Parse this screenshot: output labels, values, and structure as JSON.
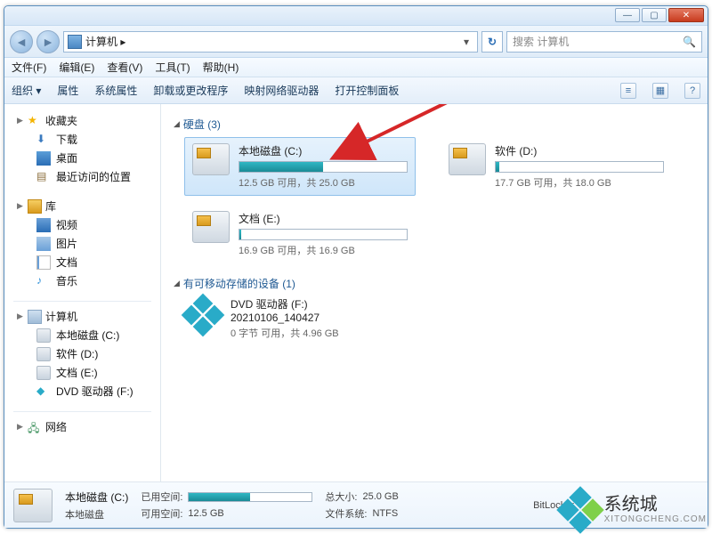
{
  "window_controls": {
    "min": "—",
    "max": "▢",
    "close": "✕"
  },
  "nav": {
    "back": "◄",
    "fwd": "►",
    "breadcrumb_icon": "pc",
    "breadcrumb": "计算机 ▸",
    "dropdown": "▾",
    "refresh": "↻",
    "search_placeholder": "搜索 计算机",
    "search_icon": "🔍"
  },
  "menubar": [
    "文件(F)",
    "编辑(E)",
    "查看(V)",
    "工具(T)",
    "帮助(H)"
  ],
  "toolbar": {
    "items": [
      "组织 ▾",
      "属性",
      "系统属性",
      "卸载或更改程序",
      "映射网络驱动器",
      "打开控制面板"
    ],
    "right_icons": [
      "≡",
      "▦",
      "?"
    ]
  },
  "sidebar": {
    "favorites": {
      "label": "收藏夹",
      "items": [
        "下载",
        "桌面",
        "最近访问的位置"
      ]
    },
    "libraries": {
      "label": "库",
      "items": [
        "视频",
        "图片",
        "文档",
        "音乐"
      ]
    },
    "computer": {
      "label": "计算机",
      "items": [
        "本地磁盘 (C:)",
        "软件 (D:)",
        "文档 (E:)",
        "DVD 驱动器 (F:)"
      ]
    },
    "network": {
      "label": "网络"
    }
  },
  "main": {
    "section_disks": {
      "label": "硬盘 (3)"
    },
    "drives": [
      {
        "title": "本地磁盘 (C:)",
        "sub": "12.5 GB 可用，共 25.0 GB",
        "fill_pct": 50,
        "selected": true
      },
      {
        "title": "软件 (D:)",
        "sub": "17.7 GB 可用，共 18.0 GB",
        "fill_pct": 2,
        "selected": false
      },
      {
        "title": "文档 (E:)",
        "sub": "16.9 GB 可用，共 16.9 GB",
        "fill_pct": 1,
        "selected": false
      }
    ],
    "section_removable": {
      "label": "有可移动存储的设备 (1)"
    },
    "dvd": {
      "line1": "DVD 驱动器 (F:)",
      "line2": "20210106_140427",
      "sub": "0 字节 可用，共 4.96 GB"
    }
  },
  "details": {
    "title": "本地磁盘 (C:)",
    "subtitle": "本地磁盘",
    "used_label": "已用空间:",
    "free_label": "可用空间:",
    "free_value": "12.5 GB",
    "total_label": "总大小:",
    "total_value": "25.0 GB",
    "fs_label": "文件系统:",
    "fs_value": "NTFS",
    "bitlocker": "BitLocker",
    "fill_pct": 50
  },
  "watermark": {
    "cn": "系统城",
    "en": "XITONGCHENG.COM"
  }
}
